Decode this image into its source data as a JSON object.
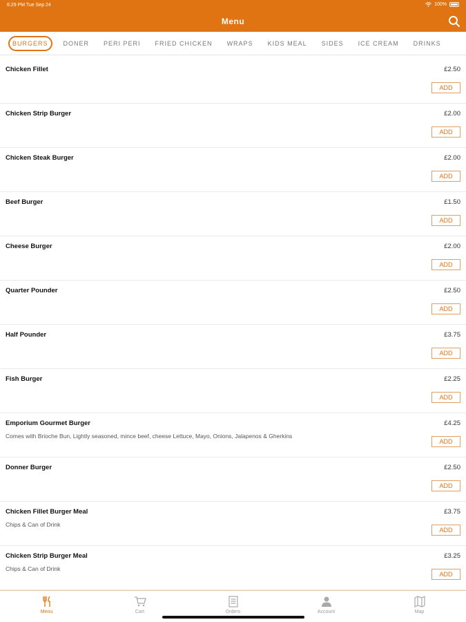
{
  "status_bar": {
    "time": "6:29 PM   Tue Sep 24",
    "battery": "100%"
  },
  "header": {
    "title": "Menu"
  },
  "colors": {
    "brand": "#e07412"
  },
  "categories": [
    {
      "label": "BURGERS",
      "active": true
    },
    {
      "label": "DONER"
    },
    {
      "label": "PERI PERI"
    },
    {
      "label": "FRIED CHICKEN"
    },
    {
      "label": "WRAPS"
    },
    {
      "label": "KIDS MEAL"
    },
    {
      "label": "SIDES"
    },
    {
      "label": "ICE CREAM"
    },
    {
      "label": "DRINKS"
    }
  ],
  "add_label": "ADD",
  "items": [
    {
      "name": "Chicken Fillet",
      "price": "£2.50",
      "description": ""
    },
    {
      "name": "Chicken Strip Burger",
      "price": "£2.00",
      "description": ""
    },
    {
      "name": "Chicken Steak Burger",
      "price": "£2.00",
      "description": ""
    },
    {
      "name": "Beef Burger",
      "price": "£1.50",
      "description": ""
    },
    {
      "name": "Cheese Burger",
      "price": "£2.00",
      "description": ""
    },
    {
      "name": "Quarter Pounder",
      "price": "£2.50",
      "description": ""
    },
    {
      "name": "Half Pounder",
      "price": "£3.75",
      "description": ""
    },
    {
      "name": "Fish Burger",
      "price": "£2.25",
      "description": ""
    },
    {
      "name": "Emporium Gourmet Burger",
      "price": "£4.25",
      "description": "Comes with Brioche Bun, Lightly seasoned, mince beef, cheese Lettuce, Mayo, Onions, Jalapenos & Gherkins"
    },
    {
      "name": "Donner Burger",
      "price": "£2.50",
      "description": ""
    },
    {
      "name": "Chicken Fillet Burger Meal",
      "price": "£3.75",
      "description": "Chips & Can of Drink"
    },
    {
      "name": "Chicken Strip Burger Meal",
      "price": "£3.25",
      "description": "Chips & Can of Drink"
    }
  ],
  "bottom_nav": [
    {
      "label": "Menu",
      "icon": "fork-knife-icon",
      "active": true
    },
    {
      "label": "Cart",
      "icon": "cart-icon"
    },
    {
      "label": "Orders",
      "icon": "orders-list-icon"
    },
    {
      "label": "Account",
      "icon": "user-icon"
    },
    {
      "label": "Map",
      "icon": "map-icon"
    }
  ]
}
